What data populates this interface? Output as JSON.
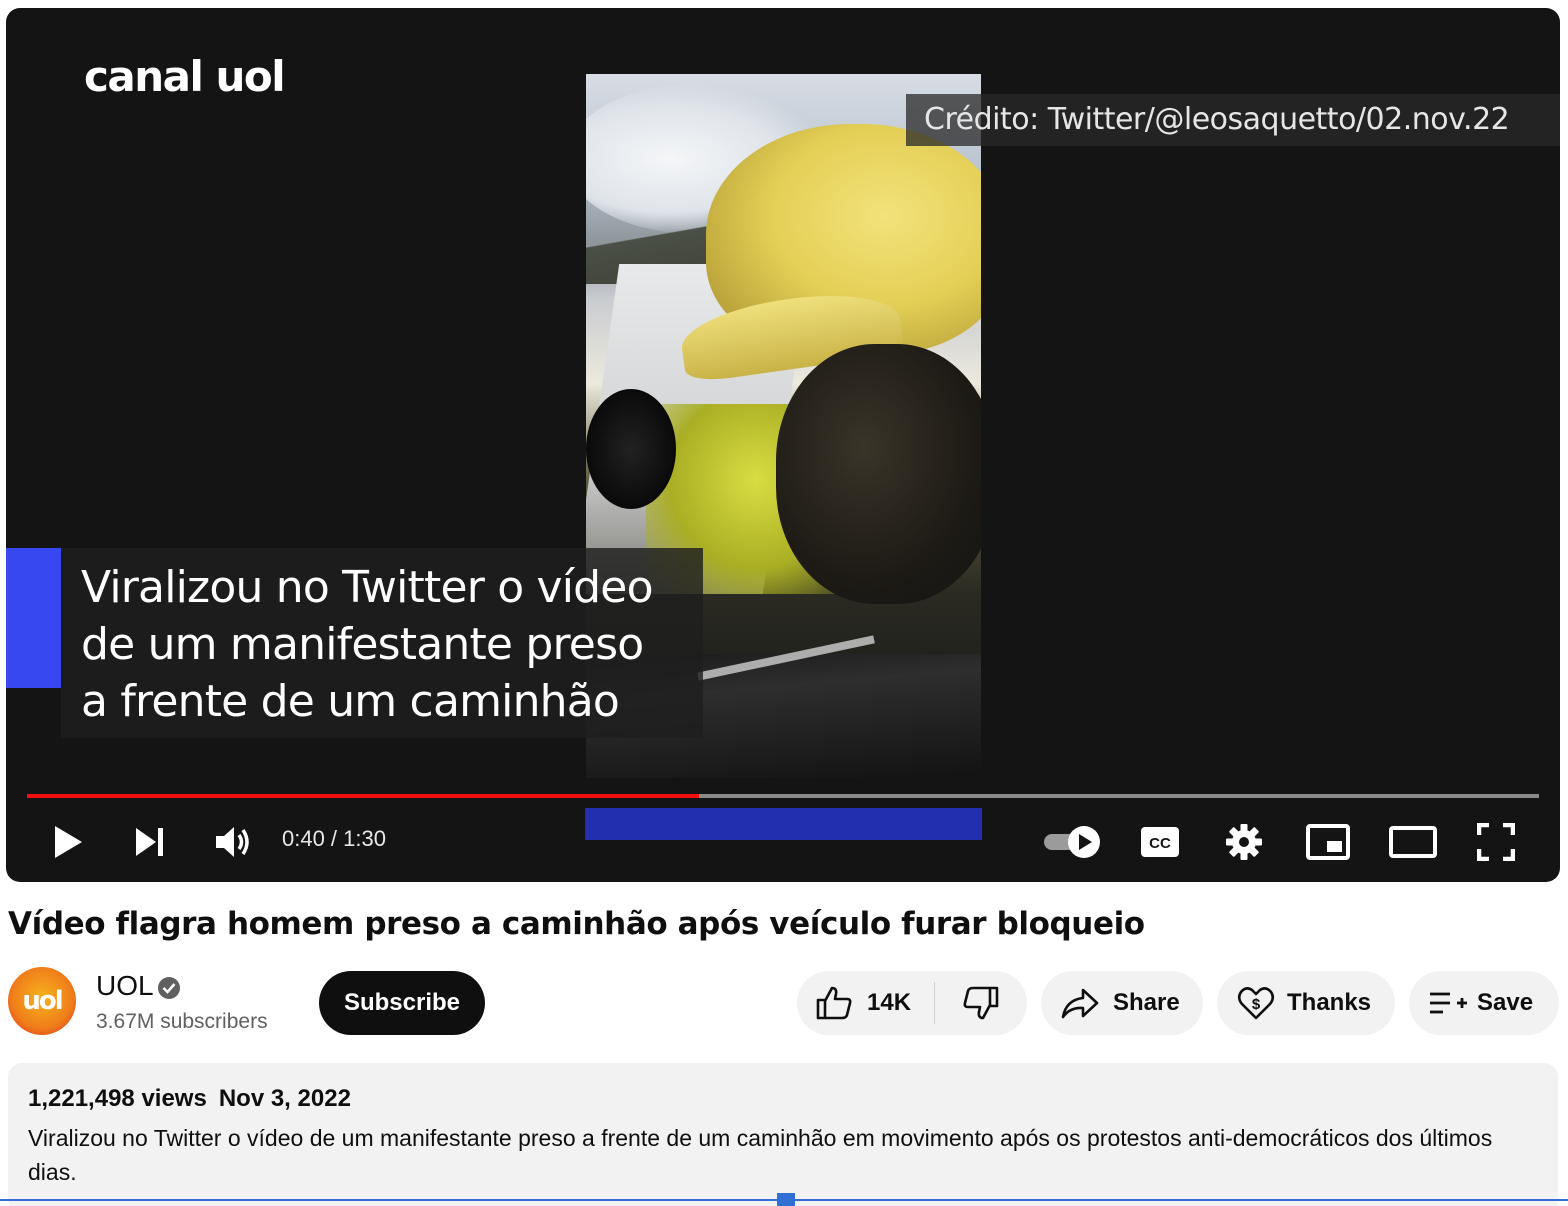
{
  "player": {
    "logo_text": "canal uol",
    "credit": "Crédito: Twitter/@leosaquetto/02.nov.22",
    "caption_lines": [
      "Viralizou no Twitter o vídeo",
      "de um manifestante preso",
      "a frente de um caminhão"
    ],
    "time_display": "0:40 / 1:30",
    "progress_fraction": 0.4444,
    "progress_color": "#f10f0f",
    "caption_accent_color": "#3848f0",
    "controls": {
      "play": "play-icon",
      "next": "next-icon",
      "volume": "volume-icon",
      "autoplay": "autoplay-toggle-icon",
      "cc": "captions-icon",
      "settings": "gear-icon",
      "miniplayer": "miniplayer-icon",
      "theater": "theater-mode-icon",
      "fullscreen": "fullscreen-icon"
    }
  },
  "video": {
    "title": "Vídeo flagra homem preso a caminhão após veículo furar bloqueio"
  },
  "channel": {
    "avatar_text": "uol",
    "name": "UOL",
    "subscribers": "3.67M subscribers",
    "subscribe_label": "Subscribe"
  },
  "actions": {
    "likes": "14K",
    "share": "Share",
    "thanks": "Thanks",
    "save": "Save"
  },
  "description": {
    "views": "1,221,498 views",
    "date": "Nov 3, 2022",
    "text": "Viralizou no Twitter o vídeo de um manifestante preso a frente de um caminhão em movimento após os protestos anti-democráticos dos últimos dias."
  }
}
